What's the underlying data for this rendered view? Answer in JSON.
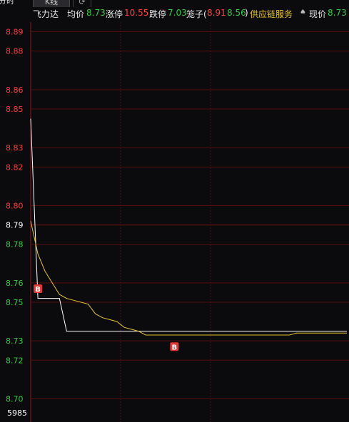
{
  "tabs": [
    "分时",
    "K线",
    "⟳"
  ],
  "header": {
    "name": "飞力达",
    "avg_label": "均价",
    "avg_value": "8.73",
    "limit_up_label": "涨停",
    "limit_up_value": "10.55",
    "limit_down_label": "跌停",
    "limit_down_value": "7.03",
    "cage_label": "笼子(",
    "cage_high": "8.91",
    "cage_low": "8.56",
    "cage_close": ")",
    "sector": "供应链服务",
    "spade": "♠",
    "now_label": "现价",
    "now_value": "8.73"
  },
  "chart_data": {
    "type": "line",
    "ylim": [
      8.688,
      8.895
    ],
    "y_ticks": [
      {
        "label": "8.89",
        "value": 8.89,
        "color": "red"
      },
      {
        "label": "8.88",
        "value": 8.88,
        "color": "red"
      },
      {
        "label": "8.86",
        "value": 8.86,
        "color": "red"
      },
      {
        "label": "8.85",
        "value": 8.85,
        "color": "red"
      },
      {
        "label": "8.83",
        "value": 8.83,
        "color": "red"
      },
      {
        "label": "8.82",
        "value": 8.82,
        "color": "red"
      },
      {
        "label": "8.80",
        "value": 8.8,
        "color": "red"
      },
      {
        "label": "8.79",
        "value": 8.79,
        "color": "white"
      },
      {
        "label": "8.78",
        "value": 8.78,
        "color": "green"
      },
      {
        "label": "8.76",
        "value": 8.76,
        "color": "green"
      },
      {
        "label": "8.75",
        "value": 8.75,
        "color": "green"
      },
      {
        "label": "8.73",
        "value": 8.73,
        "color": "green"
      },
      {
        "label": "8.72",
        "value": 8.72,
        "color": "green"
      },
      {
        "label": "8.70",
        "value": 8.7,
        "color": "green"
      }
    ],
    "bottom_label": "5985",
    "grid": true,
    "x_count": 45,
    "series": [
      {
        "values": [
          8.845,
          8.752,
          8.752,
          8.752,
          8.752,
          8.735,
          8.735,
          8.735,
          8.735,
          8.735,
          8.735,
          8.735,
          8.735,
          8.735,
          8.735,
          8.735,
          8.735,
          8.735,
          8.735,
          8.735,
          8.735,
          8.735,
          8.735,
          8.735,
          8.735,
          8.735,
          8.735,
          8.735,
          8.735,
          8.735,
          8.735,
          8.735,
          8.735,
          8.735,
          8.735,
          8.735,
          8.735,
          8.735,
          8.735,
          8.735,
          8.735,
          8.735,
          8.735,
          8.735,
          8.735
        ],
        "color": "#ffffff"
      },
      {
        "values": [
          8.792,
          8.775,
          8.766,
          8.76,
          8.754,
          8.752,
          8.751,
          8.75,
          8.749,
          8.744,
          8.742,
          8.741,
          8.74,
          8.737,
          8.736,
          8.735,
          8.733,
          8.733,
          8.733,
          8.733,
          8.733,
          8.733,
          8.733,
          8.733,
          8.733,
          8.733,
          8.733,
          8.733,
          8.733,
          8.733,
          8.733,
          8.733,
          8.733,
          8.733,
          8.733,
          8.733,
          8.733,
          8.734,
          8.734,
          8.734,
          8.734,
          8.734,
          8.734,
          8.734,
          8.734
        ],
        "color": "#e6c229"
      }
    ],
    "markers": [
      {
        "label": "B",
        "x_index": 1,
        "y": 8.757
      },
      {
        "label": "B",
        "x_index": 20,
        "y": 8.727
      }
    ]
  }
}
